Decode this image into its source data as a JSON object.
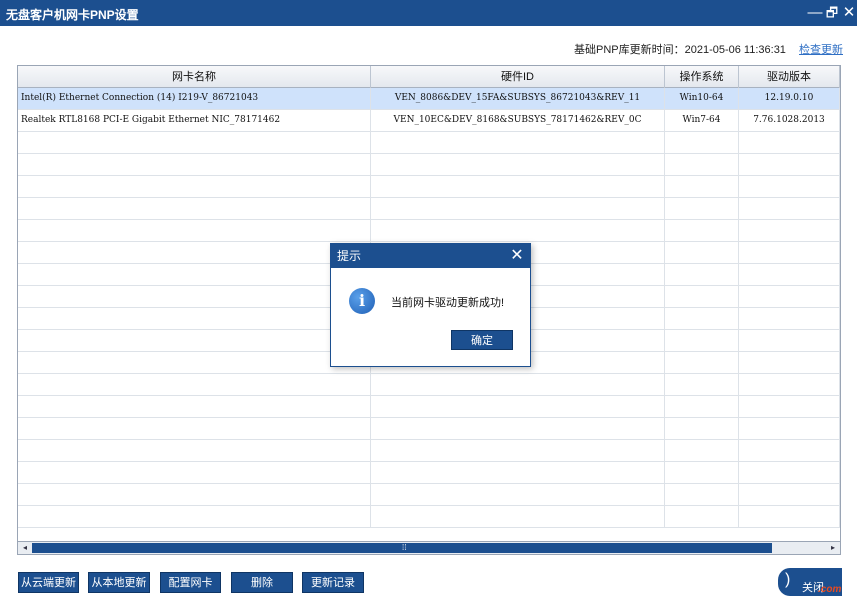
{
  "window": {
    "title": "无盘客户机网卡PNP设置",
    "controls": {
      "minimize": "—",
      "restore": "🗗",
      "close": "✕"
    }
  },
  "update_info": {
    "label": "基础PNP库更新时间：2021-05-06 11:36:31",
    "link": "检查更新"
  },
  "table": {
    "columns": [
      "网卡名称",
      "硬件ID",
      "操作系统",
      "驱动版本"
    ],
    "rows": [
      [
        "Intel(R) Ethernet Connection (14) I219-V_86721043",
        "VEN_8086&DEV_15FA&SUBSYS_86721043&REV_11",
        "Win10-64",
        "12.19.0.10"
      ],
      [
        "Realtek RTL8168 PCI-E Gigabit Ethernet NIC_78171462",
        "VEN_10EC&DEV_8168&SUBSYS_78171462&REV_0C",
        "Win7-64",
        "7.76.1028.2013"
      ]
    ],
    "selected_row": 0
  },
  "scrollbar": {
    "left_arrow": "◂",
    "right_arrow": "▸",
    "grip": "⁞⁞"
  },
  "buttons": [
    "从云端更新",
    "从本地更新",
    "配置网卡",
    "删除",
    "更新记录"
  ],
  "close_button": {
    "label": "关闭"
  },
  "watermark": ".com",
  "dialog": {
    "title": "提示",
    "close": "✕",
    "icon": "info-icon",
    "icon_glyph": "i",
    "message": "当前网卡驱动更新成功!",
    "ok": "确定"
  },
  "colors": {
    "accent": "#1c4f8f",
    "selected_row": "#cfe2fb",
    "link": "#2f6fc4"
  }
}
